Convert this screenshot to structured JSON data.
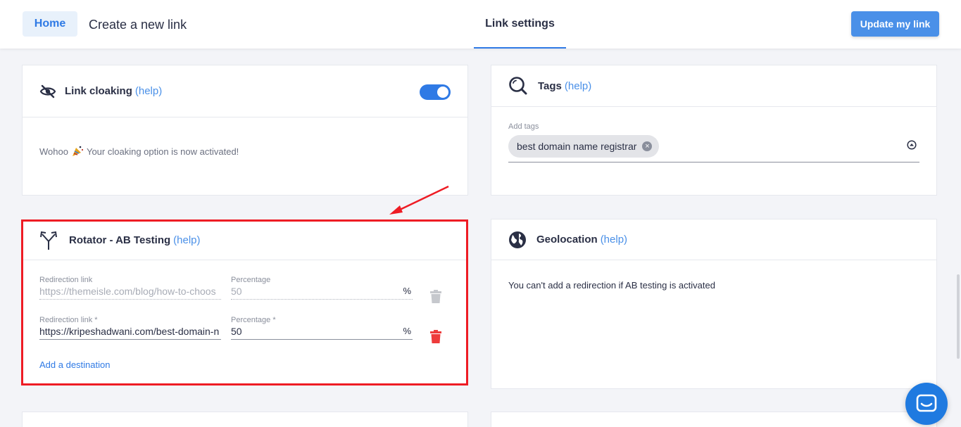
{
  "topbar": {
    "home_label": "Home",
    "create_link_label": "Create a new link",
    "active_tab_label": "Link settings",
    "update_button_label": "Update my link",
    "accent_color": "#2f7ae5"
  },
  "cloaking": {
    "title": "Link cloaking",
    "help": "(help)",
    "toggle_on": true,
    "message_prefix": "Wohoo",
    "message_suffix": "Your cloaking option is now activated!",
    "icon": "eye-slash-icon"
  },
  "tags": {
    "title": "Tags",
    "help": "(help)",
    "field_label": "Add tags",
    "chips": [
      "best domain name registrar"
    ],
    "icon": "search-icon"
  },
  "rotator": {
    "title": "Rotator - AB Testing",
    "help": "(help)",
    "icon": "split-arrows-icon",
    "rows": [
      {
        "redirect_label": "Redirection link",
        "redirect_value": "https://themeisle.com/blog/how-to-choos",
        "percent_label": "Percentage",
        "percent_value": "50",
        "unit": "%"
      },
      {
        "redirect_label": "Redirection link *",
        "redirect_value": "https://kripeshadwani.com/best-domain-n",
        "percent_label": "Percentage *",
        "percent_value": "50",
        "unit": "%"
      }
    ],
    "add_destination": "Add a destination"
  },
  "geolocation": {
    "title": "Geolocation",
    "help": "(help)",
    "message": "You can't add a redirection if AB testing is activated",
    "icon": "globe-icon"
  },
  "annotation": {
    "highlight_color": "#ee1c24"
  }
}
